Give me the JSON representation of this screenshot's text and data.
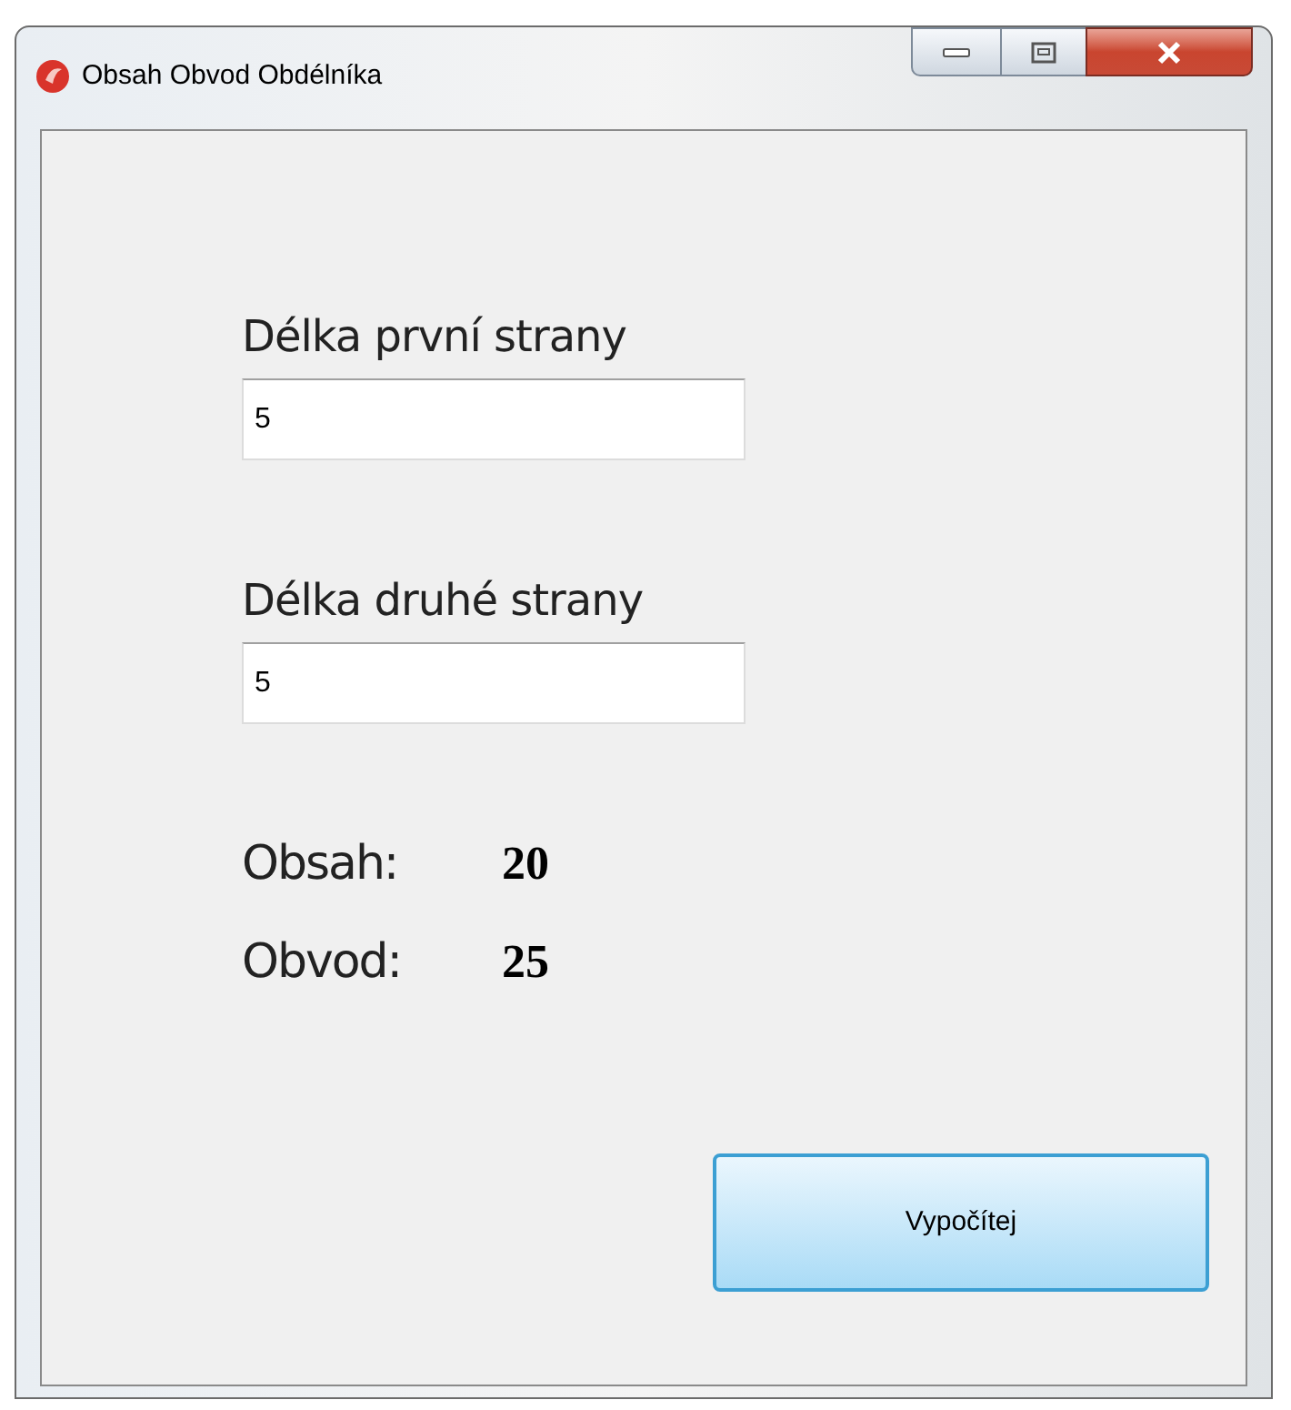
{
  "window": {
    "title": "Obsah Obvod Obdélníka"
  },
  "fields": [
    {
      "label": "Délka první strany",
      "value": "5"
    },
    {
      "label": "Délka druhé strany",
      "value": "5"
    }
  ],
  "results": [
    {
      "label": "Obsah:",
      "value": "20"
    },
    {
      "label": "Obvod:",
      "value": "25"
    }
  ],
  "button": {
    "label": "Vypočítej"
  }
}
